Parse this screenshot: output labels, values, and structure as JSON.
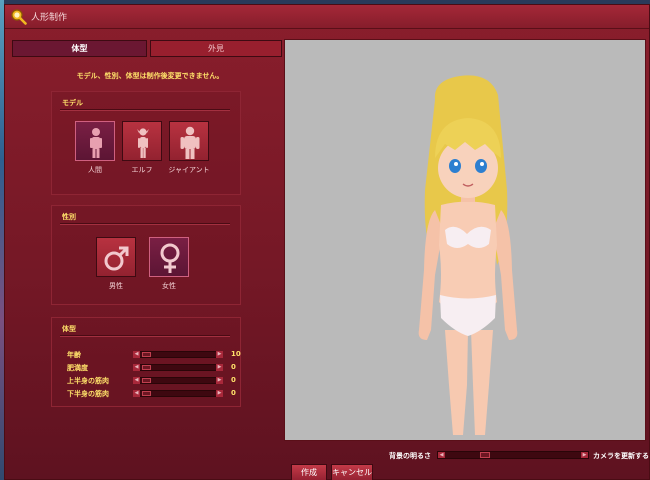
{
  "window": {
    "title": "人形制作"
  },
  "tabs": [
    {
      "label": "体型",
      "active": true
    },
    {
      "label": "外見",
      "active": false
    }
  ],
  "notice": "モデル、性別、体型は制作後変更できません。",
  "model_section": {
    "title": "モデル",
    "options": [
      {
        "label": "人間",
        "icon": "human-icon",
        "selected": true
      },
      {
        "label": "エルフ",
        "icon": "elf-icon",
        "selected": false
      },
      {
        "label": "ジャイアント",
        "icon": "giant-icon",
        "selected": false
      }
    ]
  },
  "gender_section": {
    "title": "性別",
    "options": [
      {
        "label": "男性",
        "icon": "male-icon",
        "selected": false
      },
      {
        "label": "女性",
        "icon": "female-icon",
        "selected": true
      }
    ]
  },
  "body_section": {
    "title": "体型",
    "sliders": [
      {
        "label": "年齢",
        "value": "10"
      },
      {
        "label": "肥満度",
        "value": "0"
      },
      {
        "label": "上半身の筋肉",
        "value": "0"
      },
      {
        "label": "下半身の筋肉",
        "value": "0"
      }
    ]
  },
  "preview": {
    "brightness_label": "背景の明るさ",
    "camera_reset_label": "カメラを更新する"
  },
  "footer": {
    "create_label": "作成",
    "cancel_label": "キャンセル"
  },
  "colors": {
    "window_bg": "#8a1e2c",
    "accent_text": "#ffe16a",
    "preview_bg": "#bababa",
    "selected_choice": "#6b1732"
  }
}
